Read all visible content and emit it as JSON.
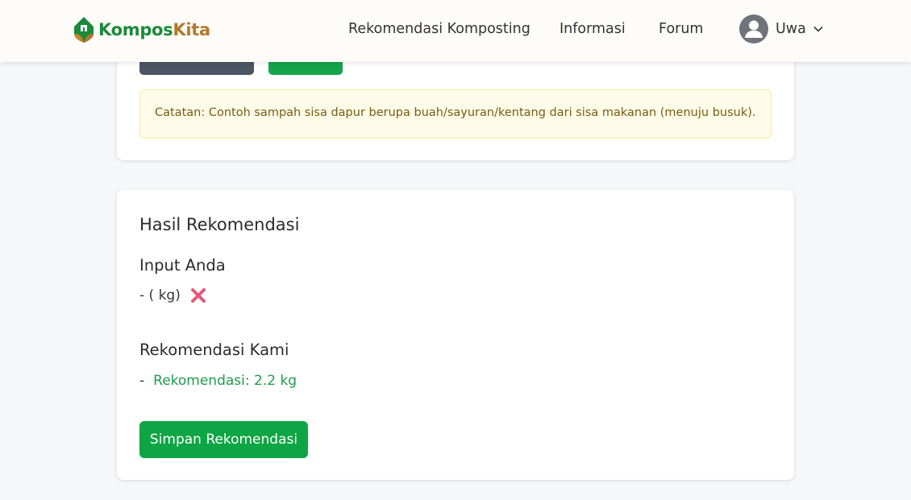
{
  "navbar": {
    "brand_part1": "Kompos",
    "brand_part2": "Kita",
    "links": [
      "Rekomendasi Komposting",
      "Informasi",
      "Forum"
    ],
    "user_name": "Uwa"
  },
  "top_card": {
    "note": "Catatan: Contoh sampah sisa dapur berupa buah/sayuran/kentang dari sisa makanan (menuju busuk)."
  },
  "result": {
    "title": "Hasil Rekomendasi",
    "input_heading": "Input Anda",
    "input_item": "- ( kg)",
    "rec_heading": "Rekomendasi Kami",
    "rec_dash": "-",
    "rec_value": "Rekomendasi: 2.2 kg",
    "save_label": "Simpan Rekomendasi"
  },
  "colors": {
    "brand_green": "#1a8b3a",
    "brand_brown": "#b07a2a",
    "primary_button": "#0ea544",
    "dark_button": "#4b5563",
    "recommendation_text": "#1f9a4c",
    "remove_icon": "#e8577a"
  },
  "icons": [
    "logo-house-leaf-icon",
    "user-avatar-icon",
    "chevron-down-icon",
    "remove-x-icon"
  ]
}
